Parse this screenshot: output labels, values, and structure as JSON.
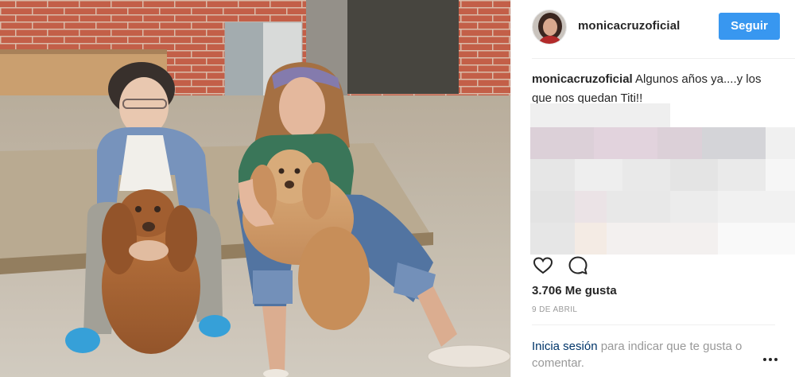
{
  "post": {
    "username": "monicacruzoficial",
    "follow_label": "Seguir",
    "caption_username": "monicacruzoficial",
    "caption_text": "Algunos años ya....y los que nos quedan Titi!!",
    "likes": "3.706 Me gusta",
    "date": "9 DE ABRIL"
  },
  "login": {
    "link": "Inicia sesión",
    "text": "para indicar que te gusta o comentar."
  },
  "icons": {
    "like": "heart-icon",
    "comment": "comment-icon",
    "more": "more-options-icon"
  },
  "colors": {
    "accent": "#3897f0",
    "link": "#003569",
    "muted": "#999999",
    "text": "#262626"
  }
}
